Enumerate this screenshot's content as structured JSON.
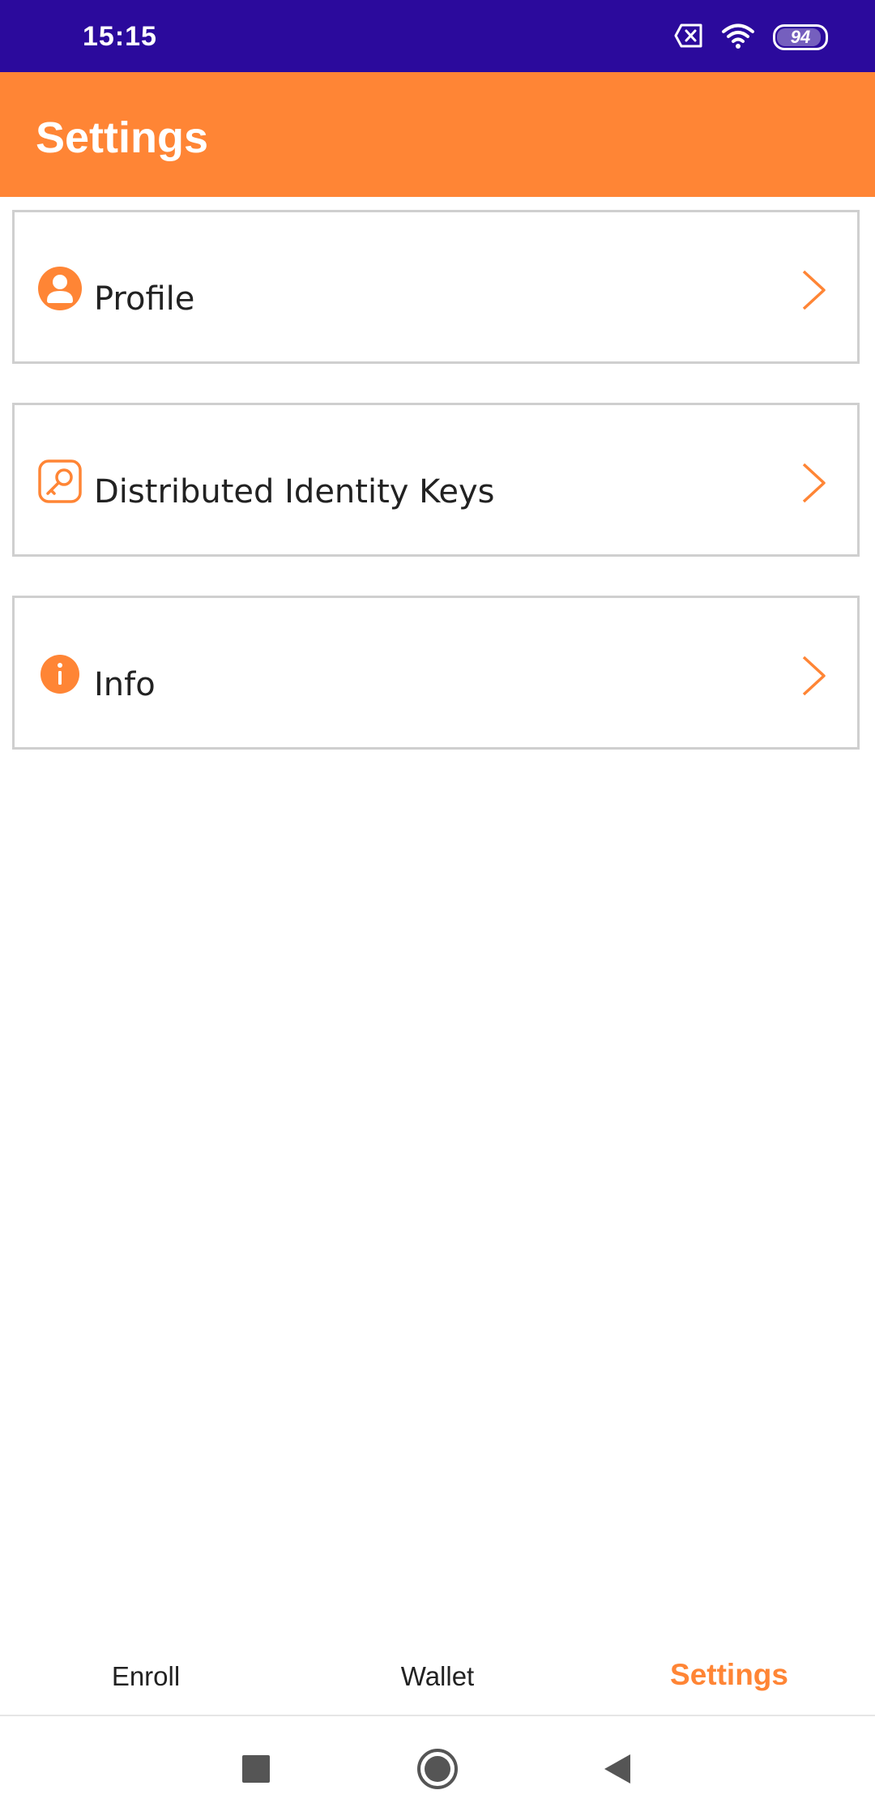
{
  "status_bar": {
    "time": "15:15",
    "battery": "94"
  },
  "app_bar": {
    "title": "Settings"
  },
  "settings_items": [
    {
      "label": "Profile",
      "icon": "person-circle-icon"
    },
    {
      "label": "Distributed Identity Keys",
      "icon": "key-square-icon"
    },
    {
      "label": "Info",
      "icon": "info-circle-icon"
    }
  ],
  "bottom_nav": {
    "items": [
      {
        "label": "Enroll"
      },
      {
        "label": "Wallet"
      },
      {
        "label": "Settings"
      }
    ],
    "active": "Settings"
  },
  "colors": {
    "accent": "#ff8535",
    "status_bar": "#2b0a9c",
    "card_border": "#cfcfcf",
    "text": "#222222"
  }
}
